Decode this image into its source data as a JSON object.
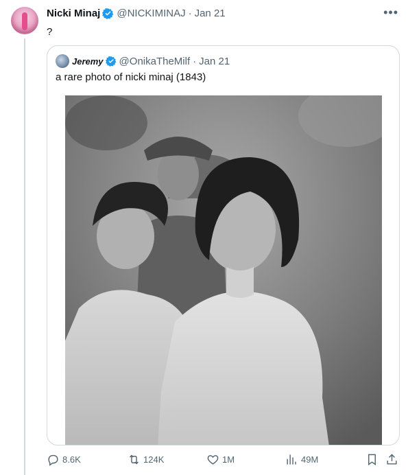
{
  "tweet": {
    "author_name": "Nicki Minaj",
    "handle": "@NICKIMINAJ",
    "separator": "·",
    "date": "Jan 21",
    "text": "?",
    "more_icon": "ellipsis-icon",
    "verified_color": "#1d9bf0"
  },
  "quoted_tweet": {
    "author_name": "Jeremy",
    "handle": "@OnikaTheMilf",
    "separator": "·",
    "date": "Jan 21",
    "text": "a rare photo of nicki minaj (1843)",
    "image_icon": "photo"
  },
  "actions": {
    "replies": "8.6K",
    "reposts": "124K",
    "likes": "1M",
    "views": "49M"
  }
}
